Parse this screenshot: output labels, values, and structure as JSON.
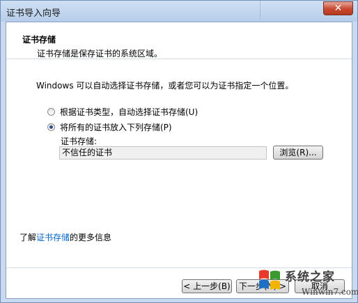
{
  "window": {
    "title": "证书导入向导",
    "close_glyph": "✕"
  },
  "header": {
    "title": "证书存储",
    "subtitle": "证书存储是保存证书的系统区域。"
  },
  "body": {
    "description": "Windows 可以自动选择证书存储，或者您可以为证书指定一个位置。",
    "options": [
      {
        "label": "根据证书类型，自动选择证书存储(U)",
        "selected": false
      },
      {
        "label": "将所有的证书放入下列存储(P)",
        "selected": true
      }
    ],
    "store_label": "证书存储:",
    "store_value": "不信任的证书",
    "browse_label": "浏览(R)..."
  },
  "learn_more": {
    "prefix": "了解",
    "link": "证书存储",
    "suffix": "的更多信息"
  },
  "footer": {
    "back_label": "< 上一步(B)",
    "next_label": "下一步(N) >",
    "cancel_label": "取消"
  },
  "watermark": {
    "brand": "系统之家",
    "url": "Winwin7.com",
    "colors": [
      "#e8392a",
      "#3a9a2e",
      "#1f6fc5",
      "#f2b400"
    ]
  }
}
